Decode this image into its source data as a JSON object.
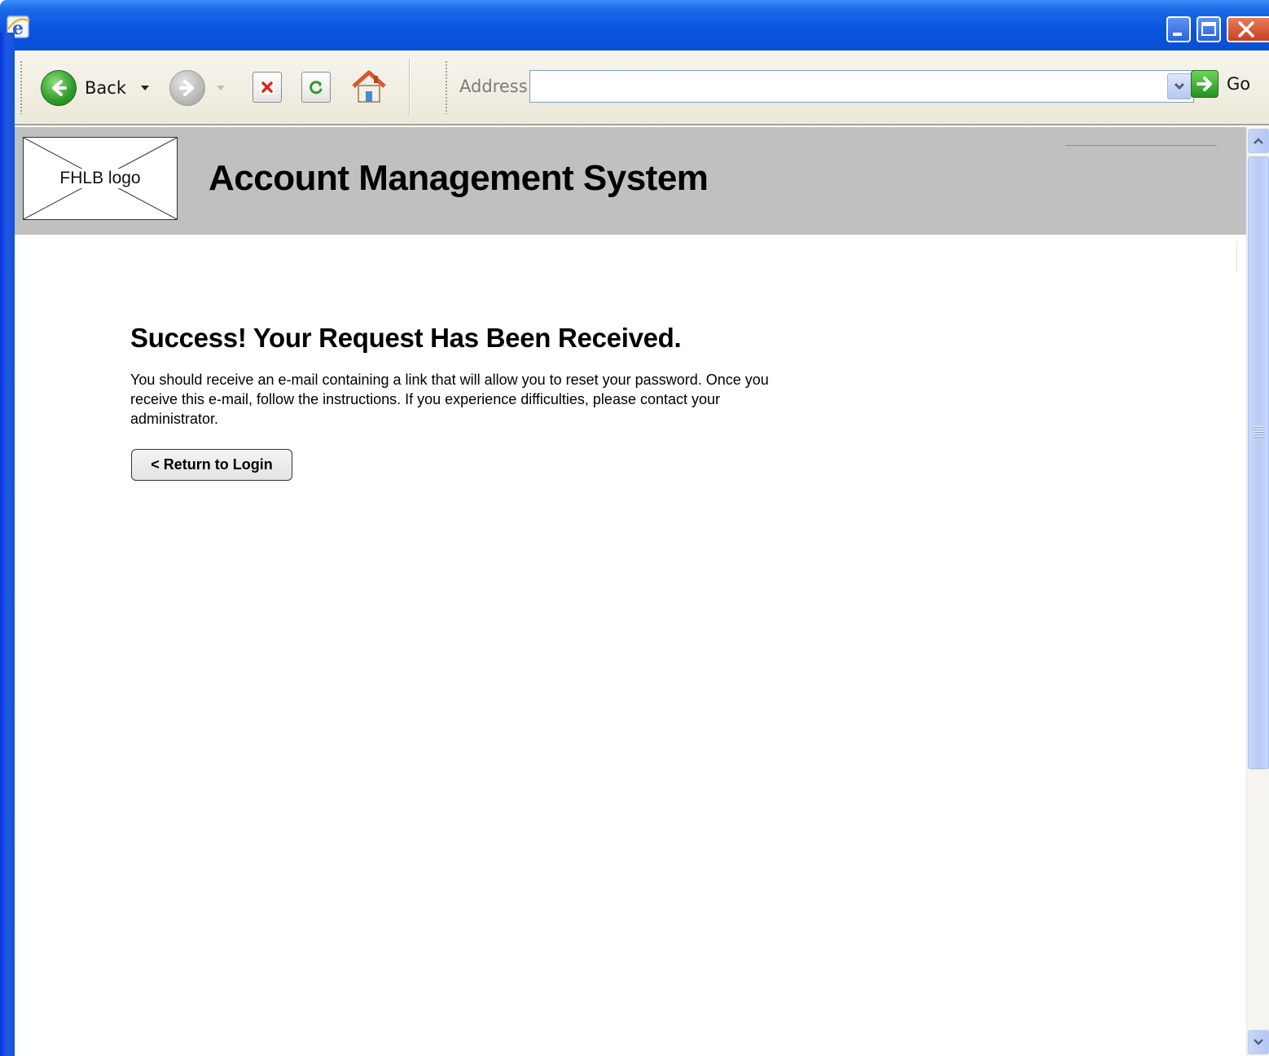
{
  "browser": {
    "toolbar": {
      "back_label": "Back",
      "address_label": "Address",
      "address_value": "",
      "go_label": "Go"
    }
  },
  "page": {
    "banner": {
      "logo_text": "FHLB logo",
      "title": "Account Management System"
    },
    "success": {
      "heading": "Success! Your Request Has Been Received.",
      "message": "You should receive an e-mail containing a link that will allow you to reset your password. Once you receive this e-mail, follow the instructions. If you experience difficulties, please contact your administrator.",
      "return_button": "< Return to Login"
    }
  },
  "colors": {
    "title_bar": "#0a55e0",
    "toolbar_bg": "#ece9d8",
    "banner_bg": "#c0c0c0",
    "scrollbar_thumb": "#b8cbf6"
  }
}
